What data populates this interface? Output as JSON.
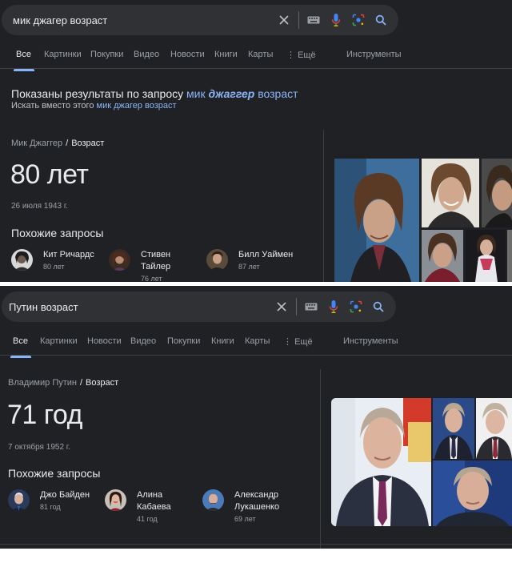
{
  "colors": {
    "background": "#202124",
    "searchbar": "#303134",
    "text": "#e8eaed",
    "muted": "#9aa0a6",
    "link": "#8ab4f8",
    "mic_blue": "#4285f4"
  },
  "search1": {
    "query": "мик джагер возраст",
    "icons": [
      "clear-icon",
      "keyboard-icon",
      "microphone-icon",
      "lens-icon",
      "search-icon"
    ],
    "tabs": {
      "all": "Все",
      "images": "Картинки",
      "shopping": "Покупки",
      "videos": "Видео",
      "news": "Новости",
      "books": "Книги",
      "maps": "Карты",
      "more": "Ещё",
      "tools": "Инструменты"
    },
    "correction": {
      "shown_prefix": "Показаны результаты по запросу",
      "shown_q1": "мик",
      "shown_q2": "джаггер",
      "shown_q3": "возраст",
      "instead_prefix": "Искать вместо этого",
      "instead_query": "мик джагер возраст"
    },
    "answer": {
      "entity": "Мик Джаггер",
      "attribute": "Возраст",
      "age": "80 лет",
      "dob": "26 июля 1943 г."
    },
    "related_title": "Похожие запросы",
    "related": [
      {
        "name": "Кит Ричардс",
        "age": "80 лет"
      },
      {
        "name": "Стивен Тайлер",
        "age": "76 лет"
      },
      {
        "name": "Билл Уаймен",
        "age": "87 лет"
      }
    ]
  },
  "search2": {
    "query": "Путин возраст",
    "icons": [
      "clear-icon",
      "keyboard-icon",
      "microphone-icon",
      "lens-icon",
      "search-icon"
    ],
    "tabs": {
      "all": "Все",
      "images": "Картинки",
      "news": "Новости",
      "videos": "Видео",
      "shopping": "Покупки",
      "books": "Книги",
      "maps": "Карты",
      "more": "Ещё",
      "tools": "Инструменты"
    },
    "answer": {
      "entity": "Владимир Путин",
      "attribute": "Возраст",
      "age": "71 год",
      "dob": "7 октября 1952 г."
    },
    "related_title": "Похожие запросы",
    "related": [
      {
        "name": "Джо Байден",
        "age": "81 год"
      },
      {
        "name": "Алина Кабаева",
        "age": "41 год"
      },
      {
        "name": "Александр Лукашенко",
        "age": "69 лет"
      }
    ]
  }
}
